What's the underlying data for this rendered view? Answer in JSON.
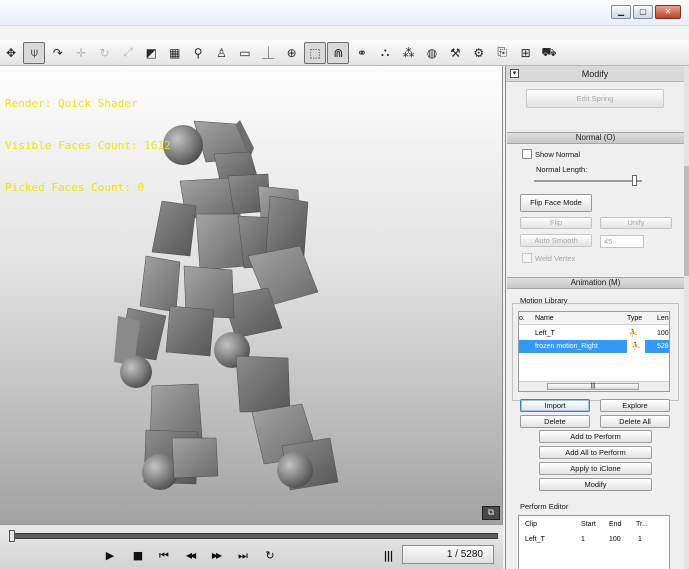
{
  "window": {
    "minimize_icon": "minimize-icon",
    "maximize_icon": "maximize-icon",
    "close_icon": "close-icon",
    "min_glyph": "▁",
    "max_glyph": "▢",
    "close_glyph": "✕"
  },
  "toolbar": {
    "tools": [
      {
        "name": "move-tool-icon",
        "glyph": "✥",
        "state": "normal"
      },
      {
        "name": "pose-tool-icon",
        "glyph": "⍦",
        "state": "active"
      },
      {
        "name": "bend-tool-icon",
        "glyph": "↷",
        "state": "normal"
      },
      {
        "name": "axis-move-icon",
        "glyph": "✛",
        "state": "faded"
      },
      {
        "name": "rotate-tool-icon",
        "glyph": "↻",
        "state": "faded"
      },
      {
        "name": "scale-tool-icon",
        "glyph": "⤢",
        "state": "faded"
      },
      {
        "name": "box-icon",
        "glyph": "◩",
        "state": "normal"
      },
      {
        "name": "grid-icon",
        "glyph": "▦",
        "state": "normal"
      },
      {
        "name": "bone-icon",
        "glyph": "⚲",
        "state": "normal"
      },
      {
        "name": "figure-icon",
        "glyph": "♙",
        "state": "normal"
      },
      {
        "name": "plane-icon",
        "glyph": "▭",
        "state": "normal"
      },
      {
        "name": "pivot-icon",
        "glyph": "⏊",
        "state": "normal"
      },
      {
        "name": "globe-icon",
        "glyph": "⊕",
        "state": "normal"
      },
      {
        "name": "select-region-icon",
        "glyph": "⬚",
        "state": "active"
      },
      {
        "name": "magnet-icon",
        "glyph": "⋒",
        "state": "active"
      },
      {
        "name": "link-icon",
        "glyph": "⚭",
        "state": "normal"
      },
      {
        "name": "nodes-icon",
        "glyph": "⛬",
        "state": "normal"
      },
      {
        "name": "color-balls-icon",
        "glyph": "⁂",
        "state": "normal"
      },
      {
        "name": "sphere-icon",
        "glyph": "◍",
        "state": "normal"
      },
      {
        "name": "wrench-icon",
        "glyph": "⚒",
        "state": "normal"
      },
      {
        "name": "settings-plus-icon",
        "glyph": "⚙",
        "state": "normal"
      },
      {
        "name": "export-icon",
        "glyph": "⎘",
        "state": "normal"
      },
      {
        "name": "package-icon",
        "glyph": "⊞",
        "state": "normal"
      },
      {
        "name": "cart-icon",
        "glyph": "⛟",
        "state": "normal"
      }
    ]
  },
  "viewport": {
    "stats": {
      "render": "Render: Quick Shader",
      "visible_faces": "Visible Faces Count: 1612",
      "picked_faces": "Picked Faces Count: 0"
    },
    "corner_button_glyph": "⧉"
  },
  "playback": {
    "play_glyph": "▶",
    "stop_glyph": "■",
    "first_glyph": "⏮",
    "rewind_glyph": "◀◀",
    "forward_glyph": "▶▶",
    "last_glyph": "⏭",
    "loop_glyph": "↻",
    "markers_glyph": "|||",
    "frame_display": "1 / 5280"
  },
  "panel": {
    "title": "Modify",
    "edit_spring": "Edit Spring",
    "normal_section": "Normal (O)",
    "show_normal": "Show Normal",
    "normal_length": "Normal Length:",
    "flip_face_mode": "Flip Face Mode",
    "flip": "Flip",
    "unify": "Unify",
    "auto_smooth": "Auto Smooth",
    "smooth_value": "45",
    "weld_vertex": "Weld Vertex",
    "animation_section": "Animation (M)",
    "motion_library": "Motion Library",
    "motion_table": {
      "headers": [
        "o.",
        "Name",
        "Type",
        "Leng"
      ],
      "rows": [
        {
          "name": "Left_T",
          "type_icon": "walk-icon",
          "type_glyph": "⛹",
          "length": "100",
          "selected": false
        },
        {
          "name": "frozen motion_Right",
          "type_icon": "walk-icon",
          "type_glyph": "⛹",
          "length": "5280",
          "selected": true
        }
      ],
      "scroll_glyph": "|||"
    },
    "buttons": {
      "import": "Import",
      "explore": "Explore",
      "delete": "Delete",
      "delete_all": "Delete All",
      "add_to_perform": "Add to Perform",
      "add_all_to_perform": "Add All to Perform",
      "apply_to_iclone": "Apply to iClone",
      "modify": "Modify"
    },
    "perform_editor": "Perform Editor",
    "perform_table": {
      "headers": [
        "Clip",
        "Start",
        "End",
        "Tr..."
      ],
      "rows": [
        {
          "clip": "Left_T",
          "start": "1",
          "end": "100",
          "tr": "1"
        }
      ]
    }
  }
}
